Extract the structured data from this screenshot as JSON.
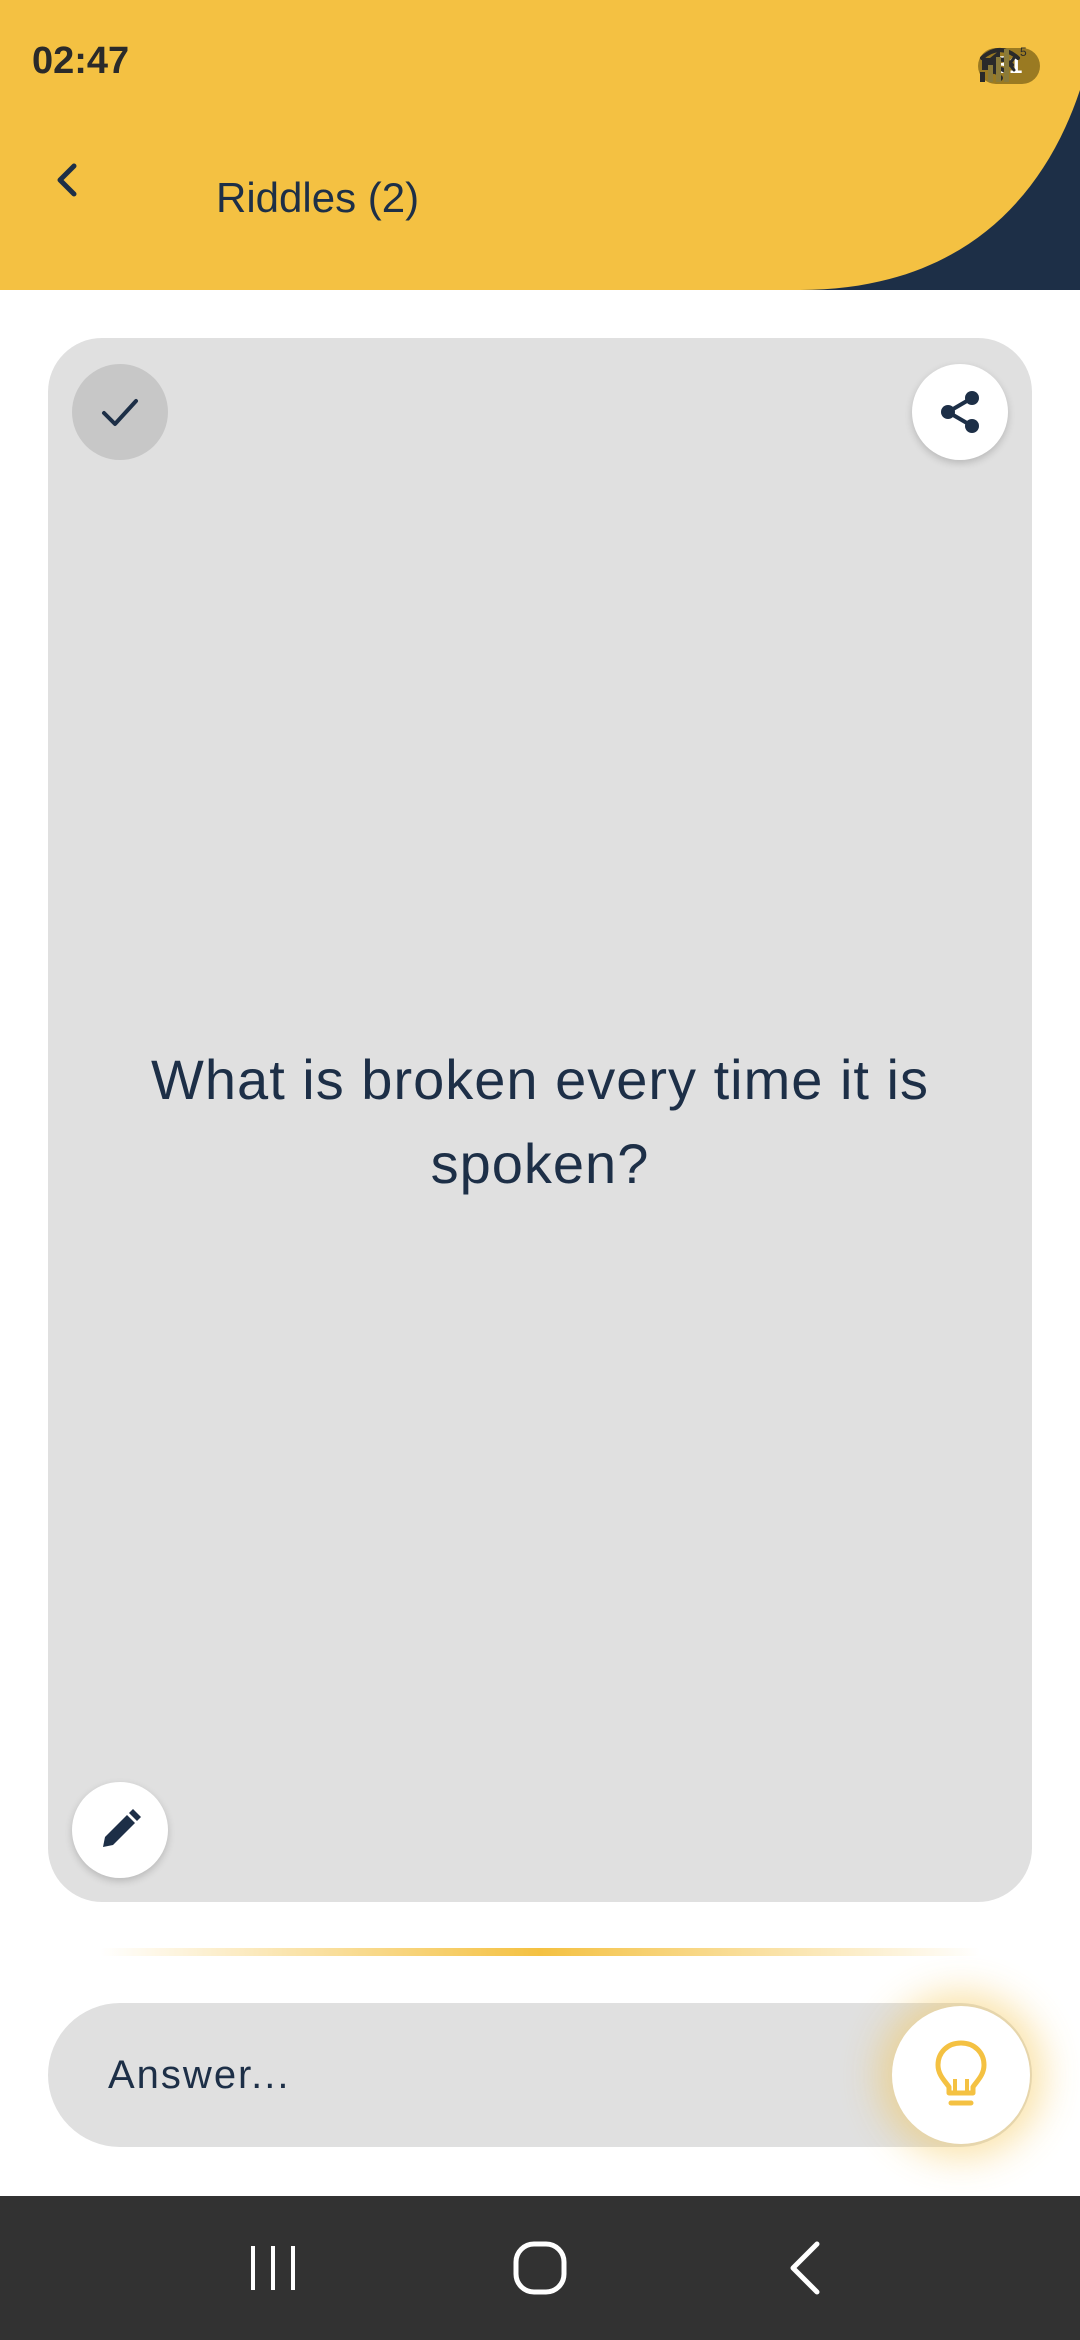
{
  "status_bar": {
    "time": "02:47",
    "battery": "31",
    "icons": [
      "mute-icon",
      "wifi-icon",
      "signal-icon",
      "battery-icon"
    ]
  },
  "header": {
    "title": "Riddles (2)",
    "back_icon": "chevron-left-icon"
  },
  "card": {
    "question": "What is broken every time it is spoken?",
    "check_icon": "check-icon",
    "share_icon": "share-icon",
    "edit_icon": "pencil-icon"
  },
  "answer": {
    "placeholder": "Answer...",
    "value": "",
    "hint_icon": "lightbulb-icon"
  },
  "nav": {
    "recents_icon": "recents-icon",
    "home_icon": "home-icon",
    "back_icon": "back-icon"
  },
  "colors": {
    "header_yellow": "#F4C142",
    "navy": "#1D2F47",
    "card_gray": "#E0E0E0",
    "navbar": "#323232"
  }
}
